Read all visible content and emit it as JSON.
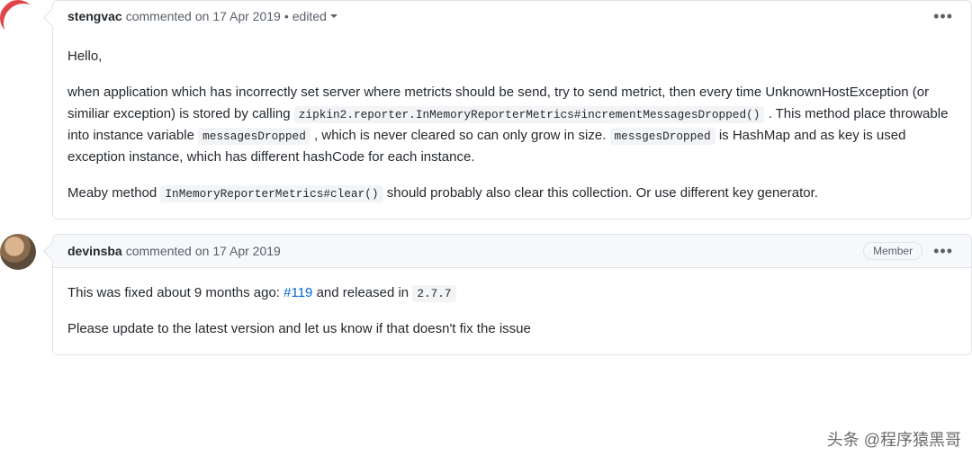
{
  "c1": {
    "author": "stengvac",
    "action": "commented",
    "on": "on 17 Apr 2019",
    "edited": "edited",
    "body": {
      "hello": "Hello,",
      "p1a": "when application which has incorrectly set server where metricts should be send, try to send metrict, then every time UnknownHostException (or similiar exception) is stored by calling ",
      "code1": "zipkin2.reporter.InMemoryReporterMetrics#incrementMessagesDropped()",
      "p2a": ". This method place throwable into instance variable ",
      "code2": "messagesDropped",
      "p2b": " , which is never cleared so can only grow in size. ",
      "code3": "messgesDropped",
      "p2c": " is HashMap and as key is used exception instance, which has different hashCode for each instance.",
      "p3a": "Meaby method ",
      "code4": "InMemoryReporterMetrics#clear()",
      "p3b": " should probably also clear this collection. Or use different key generator."
    }
  },
  "c2": {
    "author": "devinsba",
    "action": "commented",
    "on": "on 17 Apr 2019",
    "badge": "Member",
    "body": {
      "p1a": "This was fixed about 9 months ago: ",
      "link": "#119",
      "p1b": " and released in ",
      "code1": "2.7.7",
      "p2": "Please update to the latest version and let us know if that doesn't fix the issue"
    }
  },
  "watermark": "头条 @程序猿黑哥"
}
